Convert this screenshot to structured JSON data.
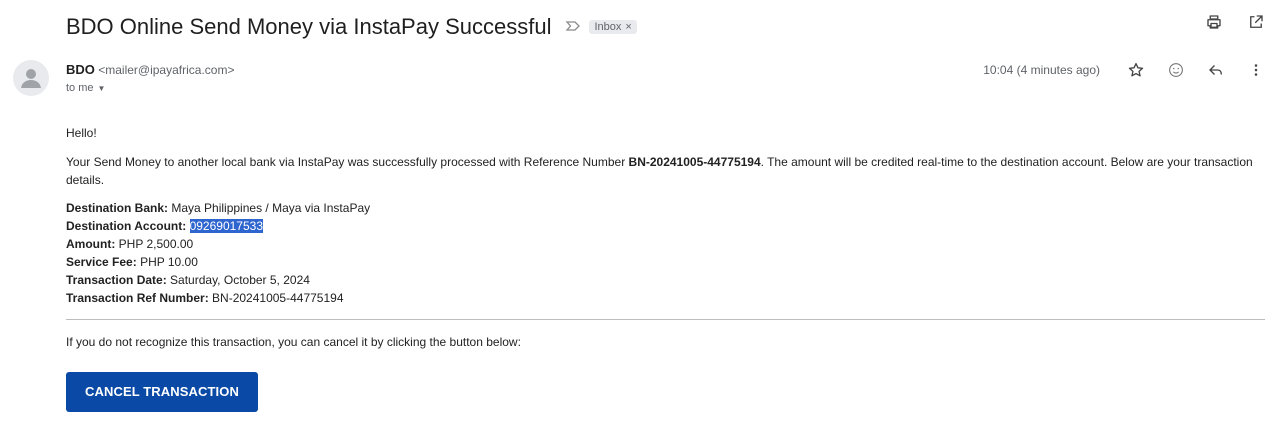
{
  "email": {
    "subject": "BDO Online Send Money via InstaPay Successful",
    "label": "Inbox",
    "sender_name": "BDO",
    "sender_email": "<mailer@ipayafrica.com>",
    "recipient": "to me",
    "time": "10:04 (4 minutes ago)"
  },
  "body": {
    "greeting": "Hello!",
    "intro_before": "Your Send Money to another local bank via InstaPay was successfully processed with Reference Number ",
    "intro_ref": "BN-20241005-44775194",
    "intro_after": ". The amount will be credited real-time to the destination account. Below are your transaction details.",
    "details": {
      "bank_label": "Destination Bank:",
      "bank_value": "Maya Philippines / Maya via InstaPay",
      "account_label": "Destination Account:",
      "account_value": "09269017533",
      "amount_label": "Amount:",
      "amount_value": "PHP 2,500.00",
      "fee_label": "Service Fee:",
      "fee_value": "PHP 10.00",
      "date_label": "Transaction Date:",
      "date_value": "Saturday, October 5, 2024",
      "ref_label": "Transaction Ref Number:",
      "ref_value": "BN-20241005-44775194"
    },
    "cancel_note": "If you do not recognize this transaction, you can cancel it by clicking the button below:",
    "cancel_button": "CANCEL TRANSACTION"
  },
  "icons": {
    "print": "print-icon",
    "open_new_window": "open-in-new-window-icon",
    "star": "star-icon",
    "emoji": "emoji-icon",
    "reply": "reply-icon",
    "more": "more-vert-icon",
    "importance": "importance-marker-icon",
    "avatar": "person-avatar-icon"
  },
  "colors": {
    "button_bg": "#0a4aa6",
    "selection_highlight": "#2f65cf",
    "label_chip_bg": "#e8eaed"
  }
}
